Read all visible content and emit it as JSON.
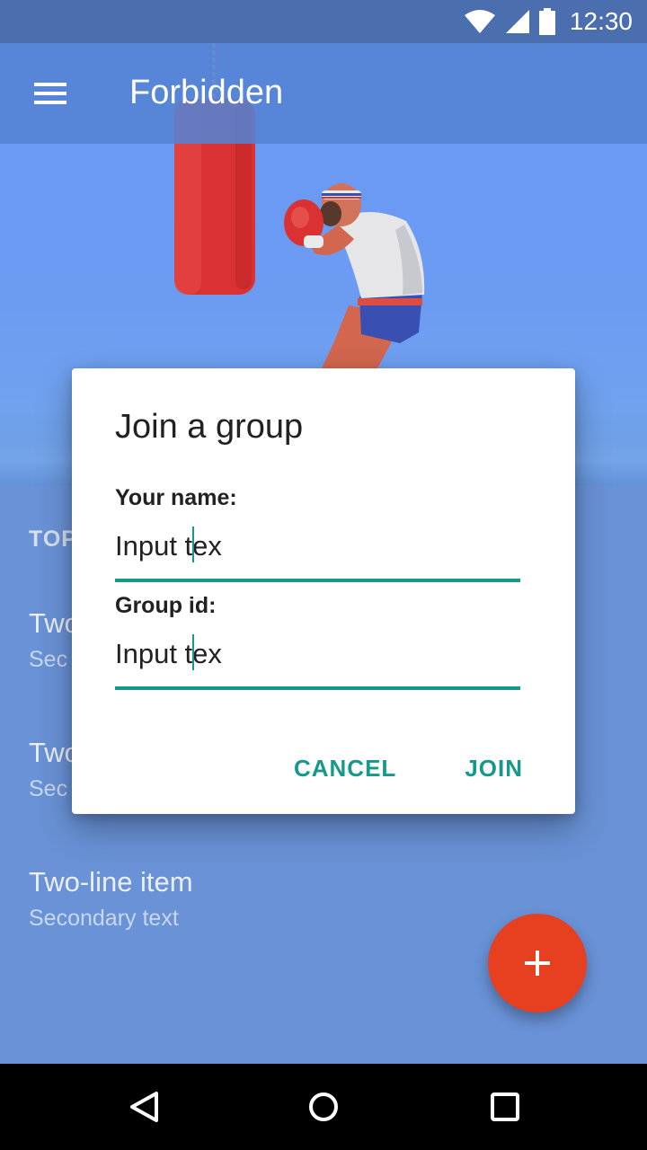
{
  "status_bar": {
    "time": "12:30",
    "icons": [
      "wifi-icon",
      "signal-icon",
      "battery-icon"
    ]
  },
  "app_bar": {
    "title": "Forbidden",
    "menu_icon": "menu-icon"
  },
  "list": {
    "subheader": "TOP",
    "items": [
      {
        "primary": "Two",
        "secondary": "Sec"
      },
      {
        "primary": "Two",
        "secondary": "Sec"
      },
      {
        "primary": "Two-line item",
        "secondary": "Secondary text"
      }
    ]
  },
  "dialog": {
    "title": "Join a group",
    "fields": [
      {
        "label": "Your name:",
        "value": "Input tex"
      },
      {
        "label": "Group id:",
        "value": "Input tex"
      }
    ],
    "buttons": {
      "cancel": "CANCEL",
      "join": "JOIN"
    }
  },
  "fab": {
    "icon": "plus-icon"
  },
  "nav_bar": {
    "icons": [
      "back-icon",
      "home-icon",
      "recents-icon"
    ]
  },
  "colors": {
    "accent": "#16998a",
    "fab": "#e64021",
    "app_bar": "#5482d2",
    "status_bar": "#4a6eae",
    "list_background": "#6d97de"
  }
}
